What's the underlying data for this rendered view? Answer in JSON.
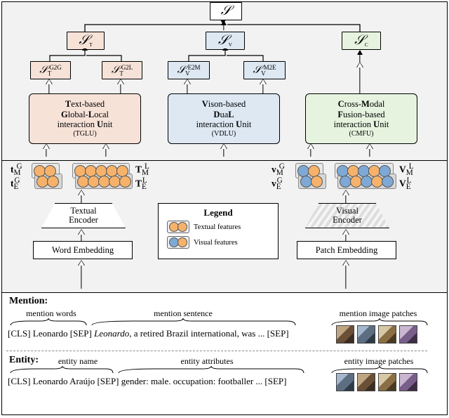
{
  "top": {
    "score_final": "𝒮",
    "score_T": "𝒮_T",
    "score_V": "𝒮_V",
    "score_C": "𝒮_C",
    "st_g2g": "𝒮_T^G2G",
    "st_g2l": "𝒮_T^G2L",
    "sv_e2m": "𝒮_V^E2M",
    "sv_m2e": "𝒮_V^M2E",
    "unit_t_l1": "Text-based",
    "unit_t_l2": "Global-Local",
    "unit_t_l3": "interaction Unit",
    "unit_t_abbr": "(TGLU)",
    "unit_v_l1": "Vison-based",
    "unit_v_l2": "DuaL",
    "unit_v_l3": "interaction Unit",
    "unit_v_abbr": "(VDLU)",
    "unit_c_l1": "Cross-Modal",
    "unit_c_l2": "Fusion-based",
    "unit_c_l3": "interaction Unit",
    "unit_c_abbr": "(CMFU)"
  },
  "mid": {
    "tMG": "t_M^G",
    "tEG": "t_E^G",
    "TML": "T_M^L",
    "TEL": "T_E^L",
    "vMG": "v_M^G",
    "vEG": "v_E^G",
    "VML": "V_M^L",
    "VEL": "V_E^L",
    "tex_enc": "Textual\nEncoder",
    "vis_enc": "Visual\nEncoder",
    "word_emb": "Word Embedding",
    "patch_emb": "Patch Embedding",
    "legend_title": "Legend",
    "legend_text": "Textual features",
    "legend_visual": "Visual features"
  },
  "bot": {
    "mention_head": "Mention:",
    "entity_head": "Entity:",
    "mention_words": "mention words",
    "mention_sentence": "mention sentence",
    "mention_patches": "mention image patches",
    "entity_name": "entity name",
    "entity_attrs": "entity attributes",
    "entity_patches": "entity image patches",
    "mention_tokens": "[CLS] Leonardo [SEP] Leonardo, a retired Brazil international, was ... [SEP]",
    "entity_tokens": "[CLS] Leonardo Araújo [SEP] gender: male. occupation: footballer ... [SEP]"
  }
}
